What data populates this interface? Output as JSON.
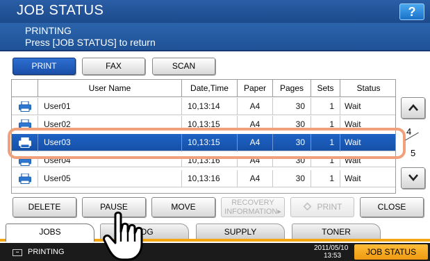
{
  "header": {
    "title": "JOB STATUS",
    "help_label": "?",
    "message_line1": "PRINTING",
    "message_line2": "Press [JOB STATUS] to return"
  },
  "type_tabs": [
    {
      "label": "PRINT",
      "active": true
    },
    {
      "label": "FAX",
      "active": false
    },
    {
      "label": "SCAN",
      "active": false
    }
  ],
  "table": {
    "columns": [
      "User Name",
      "Date,Time",
      "Paper",
      "Pages",
      "Sets",
      "Status"
    ],
    "rows": [
      {
        "user": "User01",
        "datetime": "10,13:14",
        "paper": "A4",
        "pages": "30",
        "sets": "1",
        "status": "Wait",
        "selected": false
      },
      {
        "user": "User02",
        "datetime": "10,13:15",
        "paper": "A4",
        "pages": "30",
        "sets": "1",
        "status": "Wait",
        "selected": false
      },
      {
        "user": "User03",
        "datetime": "10,13:15",
        "paper": "A4",
        "pages": "30",
        "sets": "1",
        "status": "Wait",
        "selected": true
      },
      {
        "user": "User04",
        "datetime": "10,13:16",
        "paper": "A4",
        "pages": "30",
        "sets": "1",
        "status": "Wait",
        "selected": false
      },
      {
        "user": "User05",
        "datetime": "10,13:16",
        "paper": "A4",
        "pages": "30",
        "sets": "1",
        "status": "Wait",
        "selected": false
      }
    ]
  },
  "pager": {
    "current": "4",
    "total": "5"
  },
  "actions": {
    "delete": "DELETE",
    "pause": "PAUSE",
    "move": "MOVE",
    "recovery_line1": "RECOVERY",
    "recovery_line2": "INFORMATION",
    "print": "PRINT",
    "close": "CLOSE"
  },
  "bottom_tabs": [
    {
      "label": "JOBS",
      "active": true
    },
    {
      "label": "LOG",
      "active": false
    },
    {
      "label": "SUPPLY",
      "active": false
    },
    {
      "label": "TONER",
      "active": false
    }
  ],
  "status_bar": {
    "status": "PRINTING",
    "date": "2011/05/10",
    "time": "13:53",
    "job_status_label": "JOB STATUS"
  },
  "colors": {
    "header_blue": "#1c4a8c",
    "selection_blue": "#1f63c4",
    "highlight_ring": "#f0a07a",
    "accent_orange": "#f5a614"
  },
  "icons": [
    "printer-icon",
    "scroll-up-icon",
    "scroll-down-icon",
    "print-diamond-icon",
    "hand-cursor-icon",
    "status-printing-icon"
  ]
}
